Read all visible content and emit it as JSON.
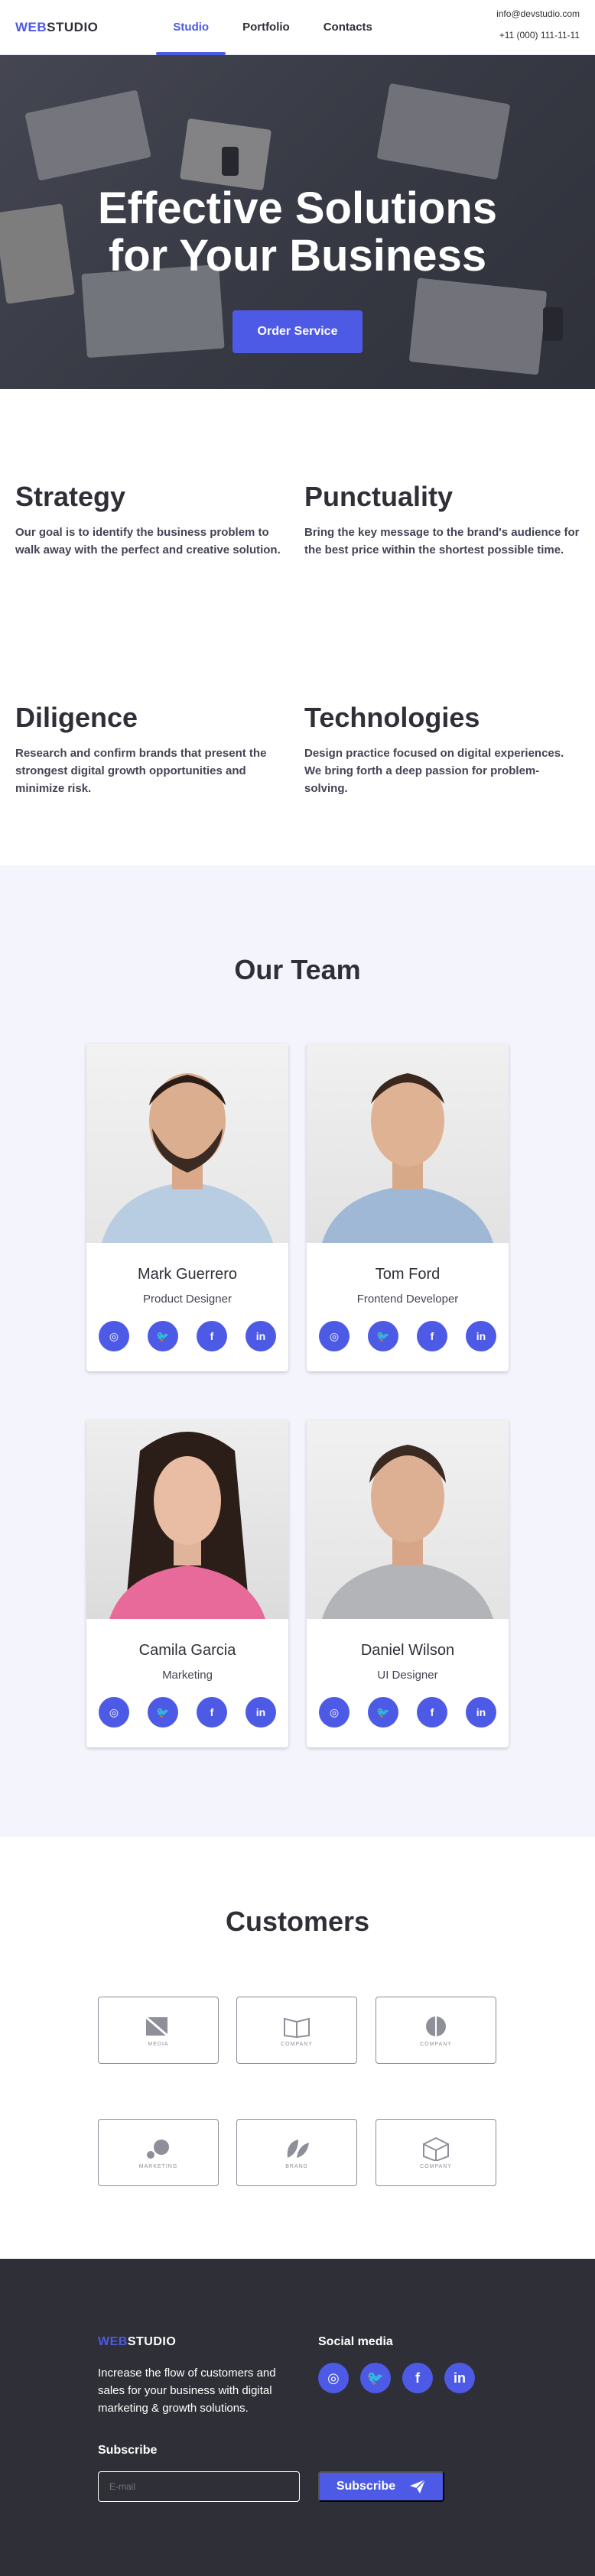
{
  "header": {
    "logo_accent": "WEB",
    "logo_rest": "STUDIO",
    "nav": [
      {
        "label": "Studio",
        "active": true
      },
      {
        "label": "Portfolio",
        "active": false
      },
      {
        "label": "Contacts",
        "active": false
      }
    ],
    "email": "info@devstudio.com",
    "phone": "+11 (000) 111-11-11"
  },
  "hero": {
    "title_line1": "Effective Solutions",
    "title_line2": "for Your Business",
    "cta_label": "Order Service"
  },
  "features": [
    {
      "title": "Strategy",
      "text": "Our goal is to identify the business problem to walk away with the perfect and creative solution."
    },
    {
      "title": "Punctuality",
      "text": "Bring the key message to the brand's audience for the best price within the shortest possible time."
    },
    {
      "title": "Diligence",
      "text": "Research and confirm brands that present the strongest digital growth opportunities and minimize risk."
    },
    {
      "title": "Technologies",
      "text": "Design practice focused on digital experiences. We bring forth a deep passion for problem-solving."
    }
  ],
  "team": {
    "title": "Our Team",
    "members": [
      {
        "name": "Mark Guerrero",
        "role": "Product Designer"
      },
      {
        "name": "Tom Ford",
        "role": "Frontend Developer"
      },
      {
        "name": "Camila Garcia",
        "role": "Marketing"
      },
      {
        "name": "Daniel Wilson",
        "role": "UI Designer"
      }
    ],
    "social_icons": [
      "instagram-icon",
      "twitter-icon",
      "facebook-icon",
      "linkedin-icon"
    ]
  },
  "customers": {
    "title": "Customers",
    "logos": [
      {
        "caption": "MEDIA"
      },
      {
        "caption": "COMPANY"
      },
      {
        "caption": "COMPANY"
      },
      {
        "caption": "MARKETING"
      },
      {
        "caption": "BRAND"
      },
      {
        "caption": "COMPANY"
      }
    ]
  },
  "footer": {
    "logo_accent": "WEB",
    "logo_rest": "STUDIO",
    "text": "Increase the flow of customers and sales for your business with digital marketing & growth solutions.",
    "subscribe_label": "Subscribe",
    "email_placeholder": "E-mail",
    "subscribe_button": "Subscribe",
    "social_label": "Social media"
  },
  "colors": {
    "accent": "#4d5ae5",
    "dark": "#2f2f37",
    "team_bg": "#f4f4fd"
  }
}
